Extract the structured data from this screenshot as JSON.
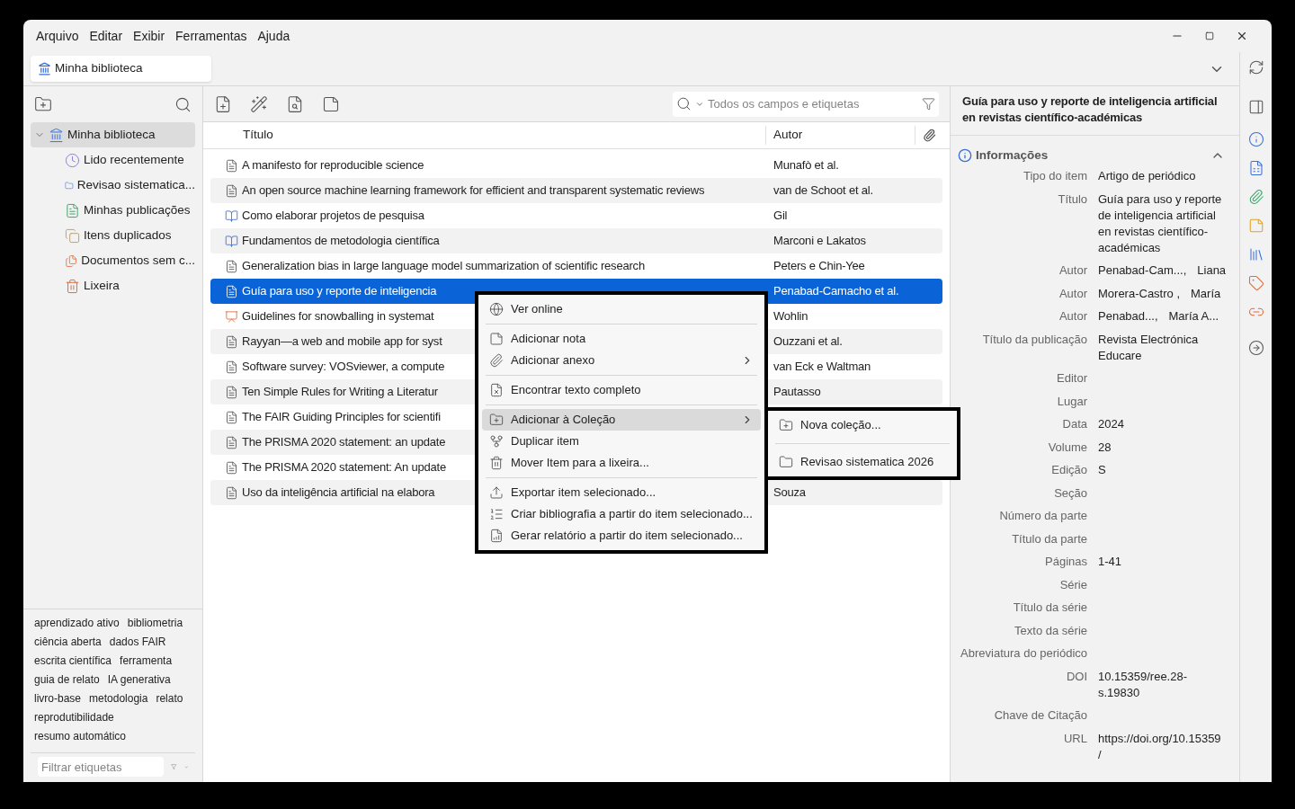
{
  "menubar": [
    "Arquivo",
    "Editar",
    "Exibir",
    "Ferramentas",
    "Ajuda"
  ],
  "library_tab": {
    "label": "Minha biblioteca"
  },
  "collections": [
    {
      "label": "Minha biblioteca",
      "kind": "library",
      "selected": true,
      "expanded": true,
      "children": [
        {
          "label": "Lido recentemente",
          "kind": "recent",
          "selected": false
        },
        {
          "label": "Revisao sistematica...",
          "kind": "folder",
          "selected": false
        },
        {
          "label": "Minhas publicações",
          "kind": "publications",
          "selected": false
        },
        {
          "label": "Itens duplicados",
          "kind": "duplicates",
          "selected": false
        },
        {
          "label": "Documentos sem c...",
          "kind": "unfiled",
          "selected": false
        },
        {
          "label": "Lixeira",
          "kind": "trash",
          "selected": false
        }
      ]
    }
  ],
  "tags": [
    "aprendizado ativo",
    "bibliometria",
    "ciência aberta",
    "dados FAIR",
    "escrita científica",
    "ferramenta",
    "guia de relato",
    "IA generativa",
    "livro-base",
    "metodologia",
    "relato",
    "reprodutibilidade",
    "resumo automático"
  ],
  "tag_filter": {
    "placeholder": "Filtrar etiquetas"
  },
  "search": {
    "placeholder": "Todos os campos e etiquetas"
  },
  "table": {
    "columns": [
      "Título",
      "Autor"
    ],
    "rows": [
      {
        "kind": "article",
        "title": "A manifesto for reproducible science",
        "author": "Munafò et al.",
        "selected": false
      },
      {
        "kind": "article",
        "title": "An open source machine learning framework for efficient and transparent systematic reviews",
        "author": "van de Schoot et al.",
        "selected": false
      },
      {
        "kind": "book",
        "title": "Como elaborar projetos de pesquisa",
        "author": "Gil",
        "selected": false
      },
      {
        "kind": "book",
        "title": "Fundamentos de metodologia científica",
        "author": "Marconi e Lakatos",
        "selected": false
      },
      {
        "kind": "article",
        "title": "Generalization bias in large language model summarization of scientific research",
        "author": "Peters e Chin-Yee",
        "selected": false
      },
      {
        "kind": "article",
        "title": "Guía para uso y reporte de inteligencia",
        "author": "Penabad-Camacho et al.",
        "selected": true
      },
      {
        "kind": "presentation",
        "title": "Guidelines for snowballing in systemat",
        "author": "Wohlin",
        "selected": false
      },
      {
        "kind": "article",
        "title": "Rayyan—a web and mobile app for syst",
        "author": "Ouzzani et al.",
        "selected": false
      },
      {
        "kind": "article",
        "title": "Software survey: VOSviewer, a compute",
        "author": "van Eck e Waltman",
        "selected": false
      },
      {
        "kind": "article",
        "title": "Ten Simple Rules for Writing a Literatur",
        "author": "Pautasso",
        "selected": false
      },
      {
        "kind": "article",
        "title": "The FAIR Guiding Principles for scientifi",
        "selected": false
      },
      {
        "kind": "article",
        "title": "The PRISMA 2020 statement: an update",
        "selected": false
      },
      {
        "kind": "article",
        "title": "The PRISMA 2020 statement: An update",
        "selected": false
      },
      {
        "kind": "article",
        "title": "Uso da inteligência artificial na elabora",
        "author": "Souza",
        "selected": false
      }
    ]
  },
  "context_menu": {
    "items": [
      {
        "kind": "item",
        "label": "Ver online",
        "selected": false
      },
      {
        "kind": "separator"
      },
      {
        "kind": "item",
        "label": "Adicionar nota",
        "selected": false
      },
      {
        "kind": "submenu",
        "label": "Adicionar anexo",
        "selected": false
      },
      {
        "kind": "separator"
      },
      {
        "kind": "item",
        "label": "Encontrar texto completo",
        "selected": false
      },
      {
        "kind": "separator"
      },
      {
        "kind": "submenu",
        "label": "Adicionar à Coleção",
        "selected": true
      },
      {
        "kind": "item",
        "label": "Duplicar item",
        "selected": false
      },
      {
        "kind": "item",
        "label": "Mover Item para a lixeira...",
        "selected": false
      },
      {
        "kind": "separator"
      },
      {
        "kind": "item",
        "label": "Exportar item selecionado...",
        "selected": false
      },
      {
        "kind": "item",
        "label": "Criar bibliografia a partir do item selecionado...",
        "selected": false
      },
      {
        "kind": "item",
        "label": "Gerar relatório a partir do item selecionado...",
        "selected": false
      }
    ]
  },
  "submenu": {
    "items": [
      {
        "kind": "item",
        "label": "Nova coleção..."
      },
      {
        "kind": "separator"
      },
      {
        "kind": "item",
        "label": "Revisao sistematica 2026"
      }
    ]
  },
  "item_pane": {
    "title": "Guía para uso y reporte de inteligencia artificial en revistas científico-académicas",
    "section": "Informações",
    "expanded": true,
    "fields": [
      {
        "kind": "text",
        "label": "Tipo do item",
        "value": "Artigo de periódico"
      },
      {
        "kind": "text",
        "label": "Título",
        "value": "Guía para uso y reporte de inteligencia artificial en revistas científico-académicas"
      },
      {
        "kind": "creator",
        "label": "Autor",
        "last": "Penabad-Cam...,",
        "first": "Liana"
      },
      {
        "kind": "creator",
        "label": "Autor",
        "last": "Morera-Castro ,",
        "first": "María"
      },
      {
        "kind": "creator",
        "label": "Autor",
        "last": "Penabad...,",
        "first": "María A..."
      },
      {
        "kind": "text",
        "label": "Título da publicação",
        "value": "Revista Electrónica Educare"
      },
      {
        "kind": "text",
        "label": "Editor"
      },
      {
        "kind": "text",
        "label": "Lugar"
      },
      {
        "kind": "text",
        "label": "Data",
        "value": "2024"
      },
      {
        "kind": "text",
        "label": "Volume",
        "value": "28"
      },
      {
        "kind": "text",
        "label": "Edição",
        "value": "S"
      },
      {
        "kind": "text",
        "label": "Seção"
      },
      {
        "kind": "text",
        "label": "Número da parte"
      },
      {
        "kind": "text",
        "label": "Título da parte"
      },
      {
        "kind": "text",
        "label": "Páginas",
        "value": "1-41"
      },
      {
        "kind": "text",
        "label": "Série"
      },
      {
        "kind": "text",
        "label": "Título da série"
      },
      {
        "kind": "text",
        "label": "Texto da série"
      },
      {
        "kind": "text",
        "label": "Abreviatura do periódico"
      },
      {
        "kind": "text",
        "label": "DOI",
        "value": "10.15359/ree.28-s.19830"
      },
      {
        "kind": "text",
        "label": "Chave de Citação"
      },
      {
        "kind": "text",
        "label": "URL",
        "value": "https://doi.org/10.15359/"
      }
    ]
  }
}
